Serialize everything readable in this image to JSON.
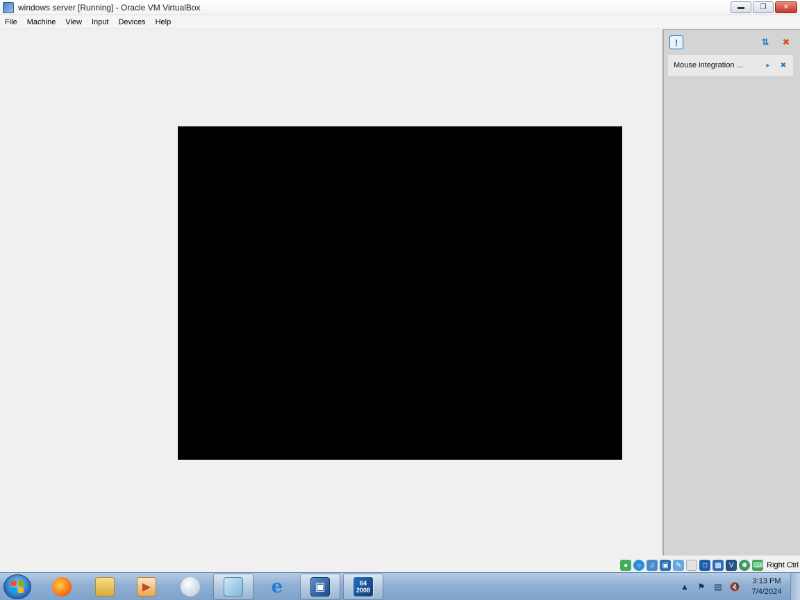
{
  "window": {
    "title": "windows server [Running] - Oracle VM VirtualBox",
    "icon": "virtualbox-app-icon",
    "controls": {
      "minimize": "minimize-icon",
      "restore": "restore-icon",
      "close": "close-icon"
    }
  },
  "menu": {
    "items": [
      {
        "label": "File"
      },
      {
        "label": "Machine"
      },
      {
        "label": "View"
      },
      {
        "label": "Input"
      },
      {
        "label": "Devices"
      },
      {
        "label": "Help"
      }
    ]
  },
  "vm_screen": {
    "state": "black",
    "background": "#000000"
  },
  "notification_center": {
    "toolbar_icons": [
      "message-icon",
      "sort-icon",
      "close-all-icon"
    ],
    "items": [
      {
        "text": "Mouse integration ...",
        "actions": [
          "toggle-icon",
          "close-icon"
        ]
      }
    ]
  },
  "statusbar": {
    "icons": [
      "hard-disk-icon",
      "optical-drive-icon",
      "audio-icon",
      "network-icon",
      "usb-icon",
      "shared-folders-icon",
      "display-icon",
      "recording-icon",
      "cpu-icon",
      "mouse-integration-icon",
      "keyboard-icon"
    ],
    "host_key": "Right Ctrl"
  },
  "taskbar": {
    "pinned": [
      {
        "name": "start-orb"
      },
      {
        "name": "firefox-icon"
      },
      {
        "name": "file-explorer-icon"
      },
      {
        "name": "media-player-icon"
      },
      {
        "name": "round-app-icon"
      },
      {
        "name": "notepad-icon"
      },
      {
        "name": "internet-explorer-icon"
      },
      {
        "name": "virtualbox-icon"
      },
      {
        "name": "windows-server-2008-icon",
        "badge_top": "64",
        "badge_bottom": "2008"
      }
    ],
    "clock": {
      "time": "3:13 PM",
      "date": "7/4/2024"
    }
  },
  "colors": {
    "accent": "#1b6fb5",
    "vm_screen": "#000000",
    "panel": "#d4d4d4",
    "taskbar": "#8fb0d4"
  }
}
